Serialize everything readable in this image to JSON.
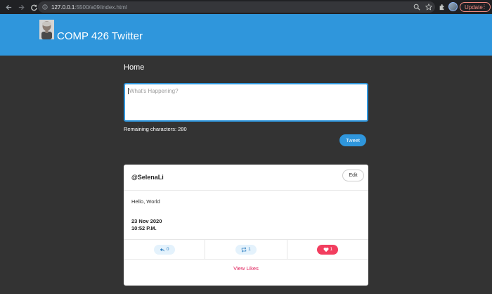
{
  "browser": {
    "url_host": "127.0.0.1",
    "url_path": ":5500/a09/index.html",
    "update_label": "Update",
    "menu_glyph": "⋮",
    "icons": [
      "back-icon",
      "forward-icon",
      "reload-icon",
      "lock-icon",
      "zoom-icon",
      "star-icon",
      "extensions-icon",
      "profile-avatar",
      "more-icon"
    ]
  },
  "header": {
    "title": "COMP 426 Twitter",
    "bg_color": "#2f96dc"
  },
  "main": {
    "page_title": "Home",
    "compose": {
      "placeholder": "What's Happening?",
      "value": ""
    },
    "remaining": "Remaining characters: 280",
    "tweet_button": "Tweet"
  },
  "tweet": {
    "username": "@SelenaLi",
    "edit_label": "Edit",
    "body": "Hello, World",
    "date": "23 Nov 2020",
    "time": "10:52 P.M.",
    "reply_count": "0",
    "retweet_count": "1",
    "like_count": "1",
    "view_likes_label": "View Likes",
    "like_color": "#f23e5f"
  }
}
